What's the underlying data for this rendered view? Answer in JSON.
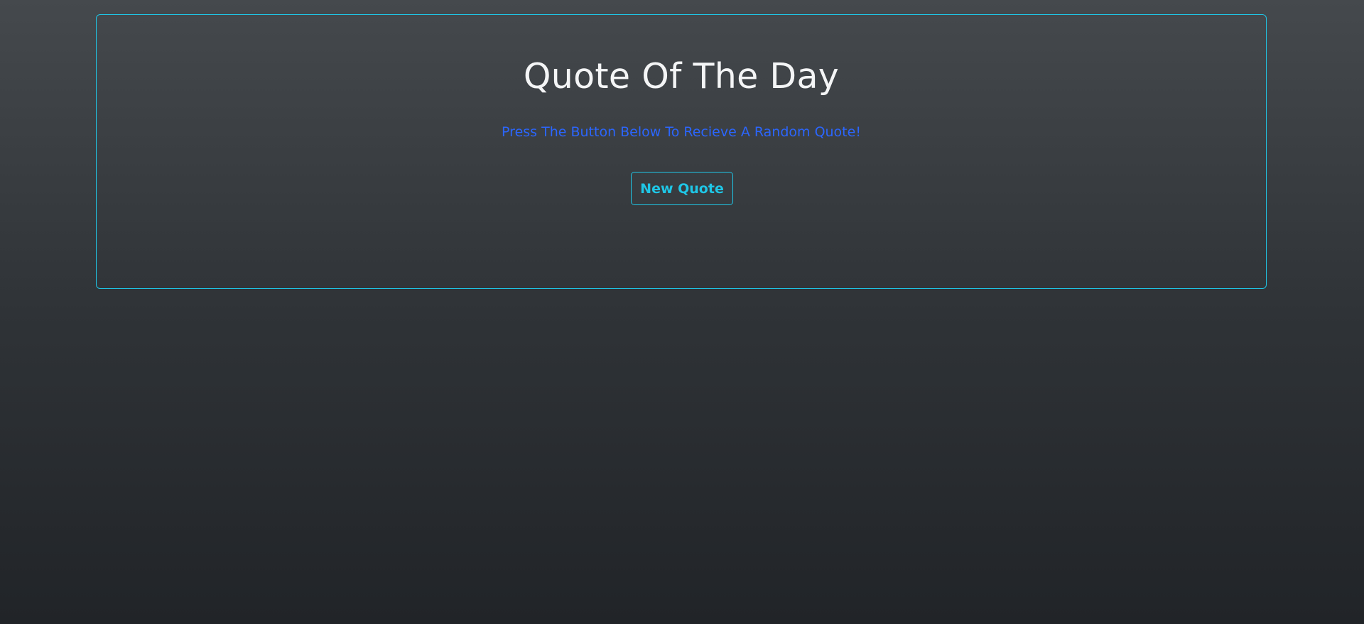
{
  "card": {
    "title": "Quote Of The Day",
    "subtitle": "Press The Button Below To Recieve A Random Quote!",
    "button_label": "New Quote"
  },
  "colors": {
    "accent": "#1fc6e6",
    "subtitle": "#2b66ff",
    "title": "#f4f5f6",
    "background_top": "#45494d",
    "background_bottom": "#212428"
  }
}
